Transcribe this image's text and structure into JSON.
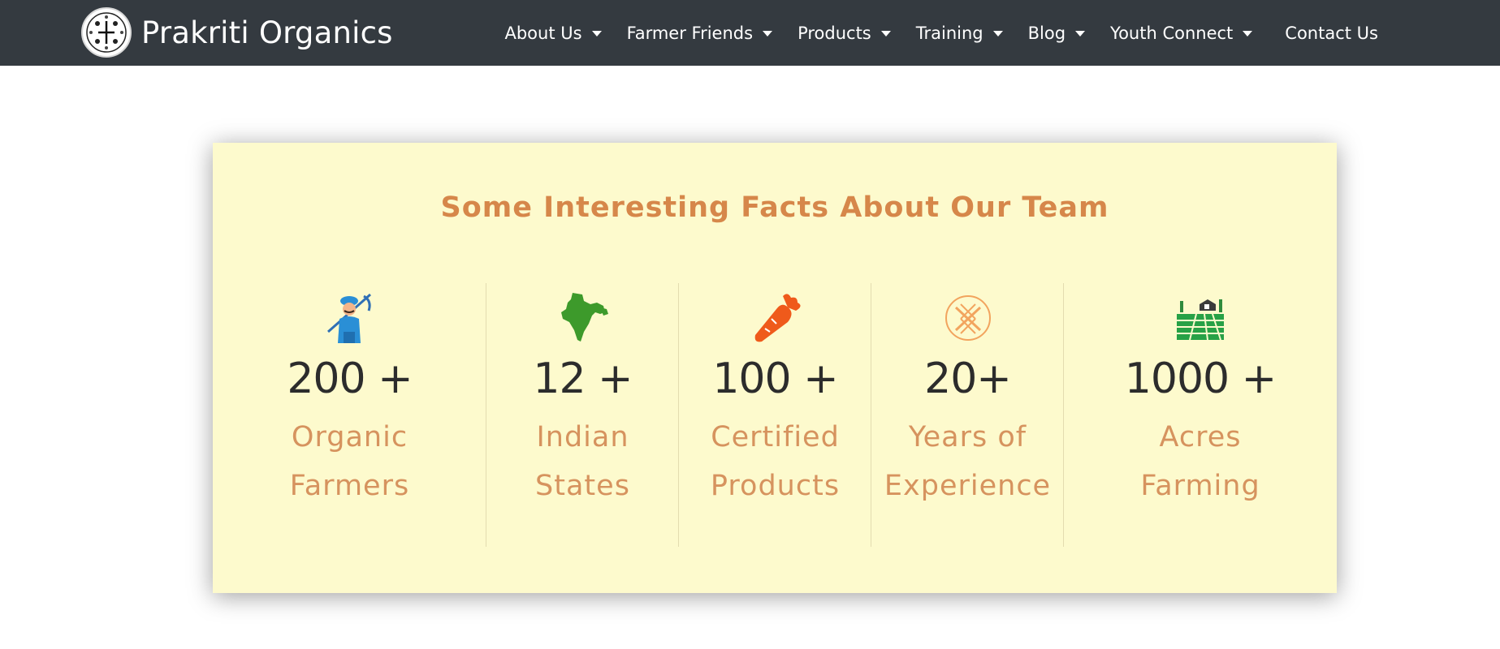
{
  "header": {
    "brand_name": "Prakriti Organics",
    "nav": [
      {
        "label": "About Us",
        "dropdown": true
      },
      {
        "label": "Farmer Friends",
        "dropdown": true
      },
      {
        "label": "Products",
        "dropdown": true
      },
      {
        "label": "Training",
        "dropdown": true
      },
      {
        "label": "Blog",
        "dropdown": true
      },
      {
        "label": "Youth Connect",
        "dropdown": true
      },
      {
        "label": "Contact Us",
        "dropdown": false
      }
    ]
  },
  "facts": {
    "title": "Some Interesting Facts About Our Team",
    "items": [
      {
        "icon": "farmer-icon",
        "number": "200 +",
        "label_line1": "Organic",
        "label_line2": "Farmers"
      },
      {
        "icon": "india-map-icon",
        "number": "12 +",
        "label_line1": "Indian",
        "label_line2": "States"
      },
      {
        "icon": "carrot-icon",
        "number": "100 +",
        "label_line1": "Certified",
        "label_line2": "Products"
      },
      {
        "icon": "experience-badge-icon",
        "number": "20+",
        "label_line1": "Years of",
        "label_line2": "Experience"
      },
      {
        "icon": "farm-field-icon",
        "number": "1000 +",
        "label_line1": "Acres",
        "label_line2": "Farming"
      }
    ]
  },
  "colors": {
    "navbar_bg": "#343a40",
    "card_bg": "#fdfacd",
    "accent_orange": "#d6874a",
    "number_text": "#2c2c2c"
  }
}
